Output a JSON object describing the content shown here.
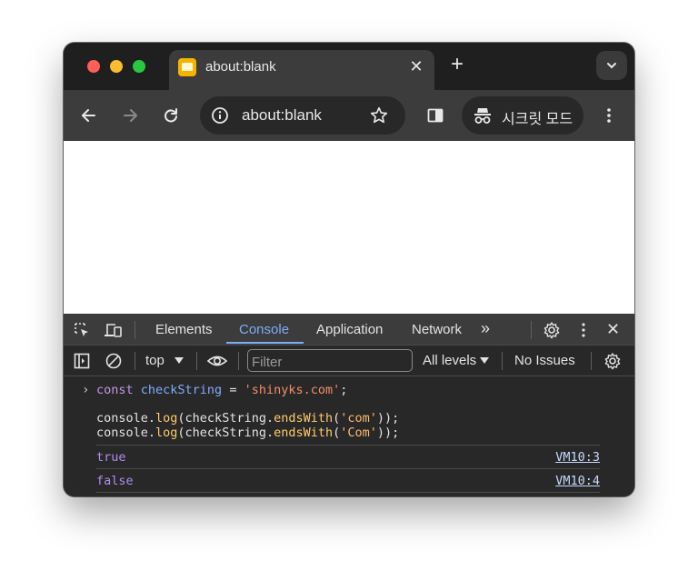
{
  "browser": {
    "tab": {
      "title": "about:blank",
      "close_glyph": "✕"
    },
    "new_tab_glyph": "+",
    "address": {
      "url": "about:blank"
    },
    "incognito_label": "시크릿 모드"
  },
  "devtools": {
    "tabs": [
      "Elements",
      "Console",
      "Application",
      "Network"
    ],
    "active_tab": "Console",
    "more_tabs_glyph": "»",
    "close_glyph": "✕",
    "context": "top",
    "filter_placeholder": "Filter",
    "levels": "All levels",
    "issues": "No Issues"
  },
  "console": {
    "input": {
      "line1": {
        "kw": "const",
        "var": "checkString",
        "op": " = ",
        "str": "'shinyks.com'",
        "end": ";"
      },
      "line2": {
        "obj": "console.",
        "fn": "log",
        "p1": "(checkString.",
        "method": "endsWith",
        "p2": "(",
        "arg": "'com'",
        "end": "));"
      },
      "line3": {
        "obj": "console.",
        "fn": "log",
        "p1": "(checkString.",
        "method": "endsWith",
        "p2": "(",
        "arg": "'Com'",
        "end": "));"
      }
    },
    "outputs": [
      {
        "value": "true",
        "source": "VM10:3"
      },
      {
        "value": "false",
        "source": "VM10:4"
      }
    ]
  },
  "colors": {
    "accent": "#7cacf8",
    "traffic_red": "#ff5f57",
    "traffic_yellow": "#febc2e",
    "traffic_green": "#28c840"
  }
}
